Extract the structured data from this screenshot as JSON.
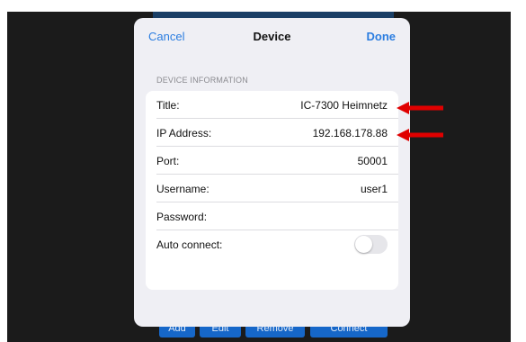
{
  "modal": {
    "cancel_label": "Cancel",
    "title": "Device",
    "done_label": "Done",
    "section_header": "DEVICE INFORMATION"
  },
  "fields": [
    {
      "label": "Title:",
      "value": "IC-7300 Heimnetz"
    },
    {
      "label": "IP Address:",
      "value": "192.168.178.88"
    },
    {
      "label": "Port:",
      "value": "50001"
    },
    {
      "label": "Username:",
      "value": "user1"
    },
    {
      "label": "Password:",
      "value": ""
    },
    {
      "label": "Auto connect:",
      "toggle_on": false
    }
  ],
  "background_buttons": [
    "Add",
    "Edit",
    "Remove",
    "Connect"
  ],
  "colors": {
    "accent": "#2b7de0",
    "annotation_arrow": "#e00000",
    "background_button": "#1667c9"
  }
}
